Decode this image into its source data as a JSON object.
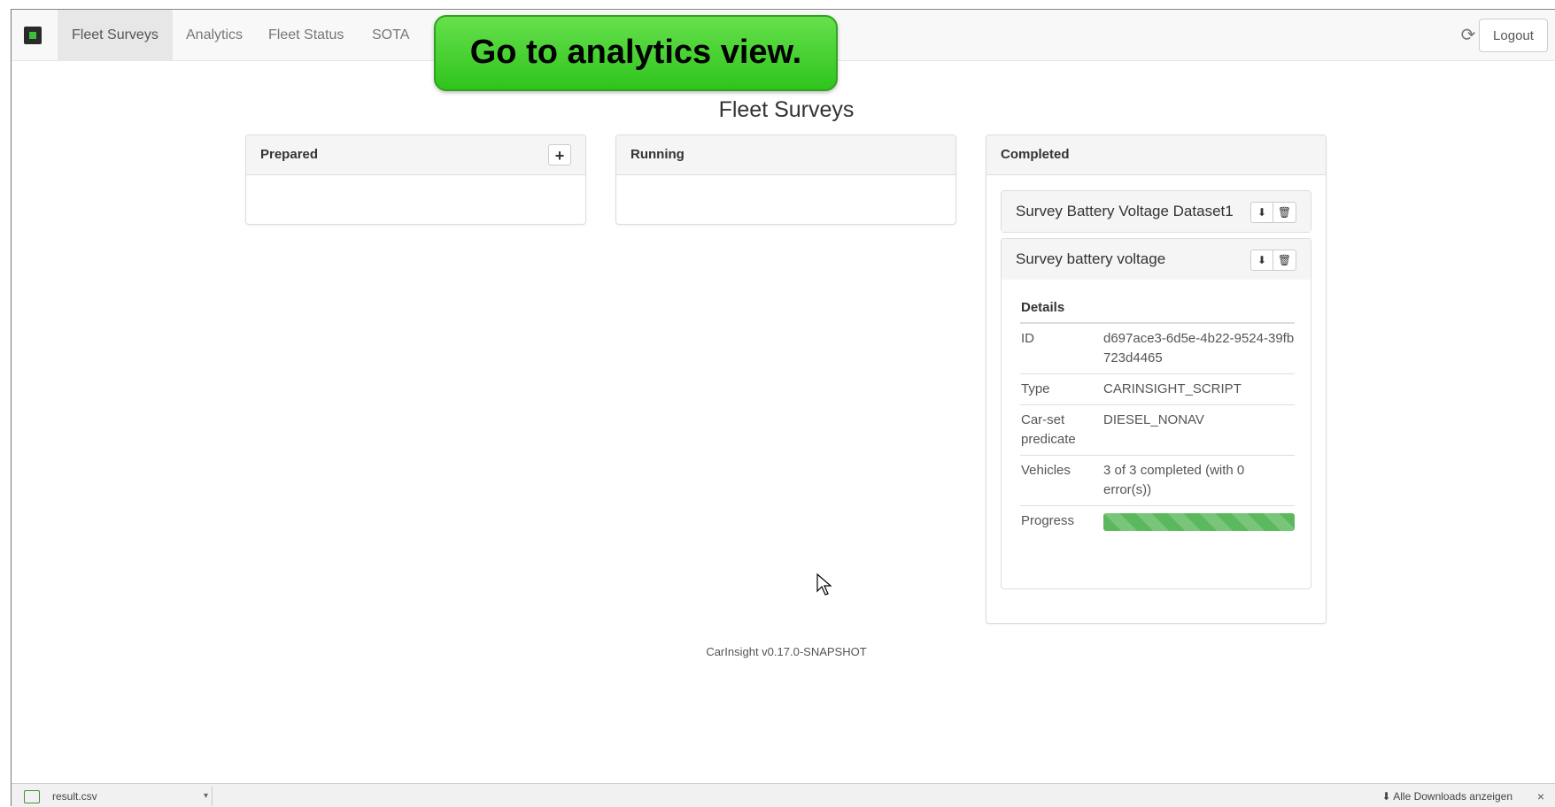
{
  "navbar": {
    "tabs": [
      {
        "label": "Fleet Surveys",
        "active": true
      },
      {
        "label": "Analytics",
        "active": false
      },
      {
        "label": "Fleet Status",
        "active": false
      },
      {
        "label": "SOTA",
        "active": false
      }
    ],
    "refresh_icon": "refresh-icon",
    "logout_label": "Logout"
  },
  "tooltip": {
    "text": "Go to analytics view."
  },
  "page": {
    "title": "Fleet Surveys"
  },
  "columns": {
    "prepared": {
      "title": "Prepared",
      "add_label": "+"
    },
    "running": {
      "title": "Running"
    },
    "completed": {
      "title": "Completed",
      "surveys": [
        {
          "name": "Survey Battery Voltage Dataset1"
        },
        {
          "name": "Survey battery voltage"
        }
      ]
    }
  },
  "details": {
    "title": "Details",
    "rows": [
      {
        "key": "ID",
        "value": "d697ace3-6d5e-4b22-9524-39fb723d4465"
      },
      {
        "key": "Type",
        "value": "CARINSIGHT_SCRIPT"
      },
      {
        "key": "Car-set predicate",
        "value": "DIESEL_NONAV"
      },
      {
        "key": "Vehicles",
        "value": "3 of 3 completed (with 0 error(s))"
      },
      {
        "key": "Progress",
        "value": ""
      }
    ],
    "progress": 1.0
  },
  "footer": {
    "text": "CarInsight v0.17.0-SNAPSHOT"
  },
  "download_bar": {
    "file_name": "result.csv",
    "show_all_label": "Alle Downloads anzeigen",
    "close_label": "×"
  },
  "colors": {
    "accent_green": "#5cb85c",
    "tooltip_green": "#3fcf2a"
  }
}
